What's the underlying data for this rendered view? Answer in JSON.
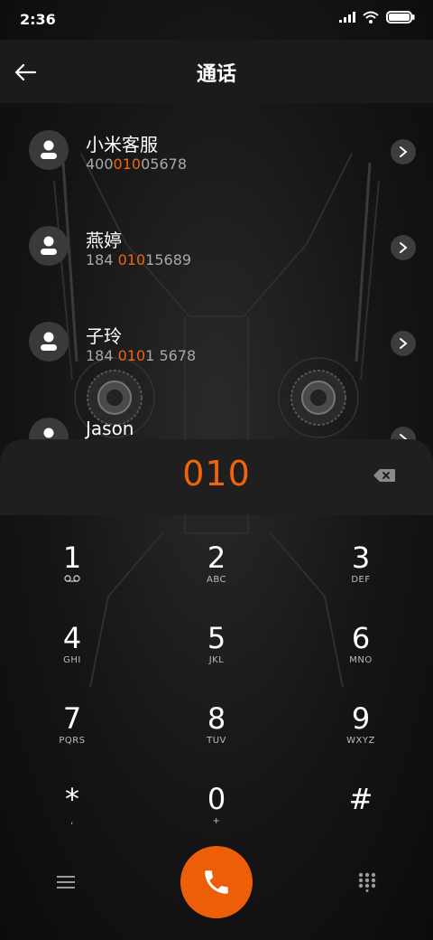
{
  "status_bar": {
    "time": "2:36"
  },
  "header": {
    "title": "通话"
  },
  "contacts": [
    {
      "name": "小米客服",
      "number_pre": "400",
      "number_hl": "010",
      "number_post": "05678"
    },
    {
      "name": "燕婷",
      "number_pre": "184 ",
      "number_hl": "010",
      "number_post": "15689"
    },
    {
      "name": "子玲",
      "number_pre": "184 ",
      "number_hl": "010",
      "number_post": "1 5678"
    },
    {
      "name": "Jason",
      "number_pre": "",
      "number_hl": "",
      "number_post": ""
    }
  ],
  "dialer": {
    "input": "010"
  },
  "keys": [
    {
      "digit": "1",
      "sub": ""
    },
    {
      "digit": "2",
      "sub": "ABC"
    },
    {
      "digit": "3",
      "sub": "DEF"
    },
    {
      "digit": "4",
      "sub": "GHI"
    },
    {
      "digit": "5",
      "sub": "JKL"
    },
    {
      "digit": "6",
      "sub": "MNO"
    },
    {
      "digit": "7",
      "sub": "PQRS"
    },
    {
      "digit": "8",
      "sub": "TUV"
    },
    {
      "digit": "9",
      "sub": "WXYZ"
    },
    {
      "digit": "*",
      "sub": ","
    },
    {
      "digit": "0",
      "sub": "+"
    },
    {
      "digit": "#",
      "sub": ""
    }
  ],
  "colors": {
    "accent": "#f0640a",
    "call_button": "#ec5f08",
    "panel": "#1f1f1f"
  },
  "icons": {
    "back": "arrow-left-icon",
    "contact": "person-icon",
    "chevron": "chevron-right-icon",
    "backspace": "backspace-icon",
    "voicemail": "voicemail-icon",
    "menu": "menu-icon",
    "call": "phone-icon",
    "dialpad": "dialpad-icon"
  }
}
